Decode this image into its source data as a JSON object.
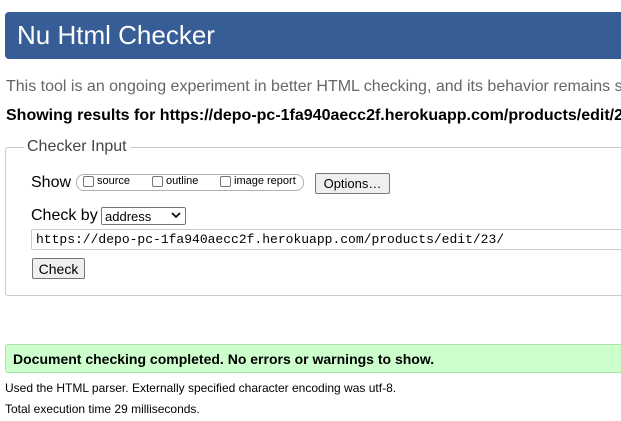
{
  "header": {
    "title": "Nu Html Checker"
  },
  "intro": {
    "text": "This tool is an ongoing experiment in better HTML checking, and its behavior remains s"
  },
  "results": {
    "heading": "Showing results for https://depo-pc-1fa940aecc2f.herokuapp.com/products/edit/2"
  },
  "checker_input": {
    "legend": "Checker Input",
    "show_label": "Show",
    "checkboxes": [
      {
        "label": "source",
        "checked": false
      },
      {
        "label": "outline",
        "checked": false
      },
      {
        "label": "image report",
        "checked": false
      }
    ],
    "options_button": "Options…",
    "check_by_label": "Check by",
    "check_by_value": "address",
    "url_value": "https://depo-pc-1fa940aecc2f.herokuapp.com/products/edit/23/",
    "check_button": "Check"
  },
  "status": {
    "success_message": "Document checking completed. No errors or warnings to show.",
    "parser_info": "Used the HTML parser. Externally specified character encoding was utf-8.",
    "execution_time": "Total execution time 29 milliseconds."
  },
  "colors": {
    "header_bg": "#365d95",
    "success_bg": "#ccffcc"
  }
}
